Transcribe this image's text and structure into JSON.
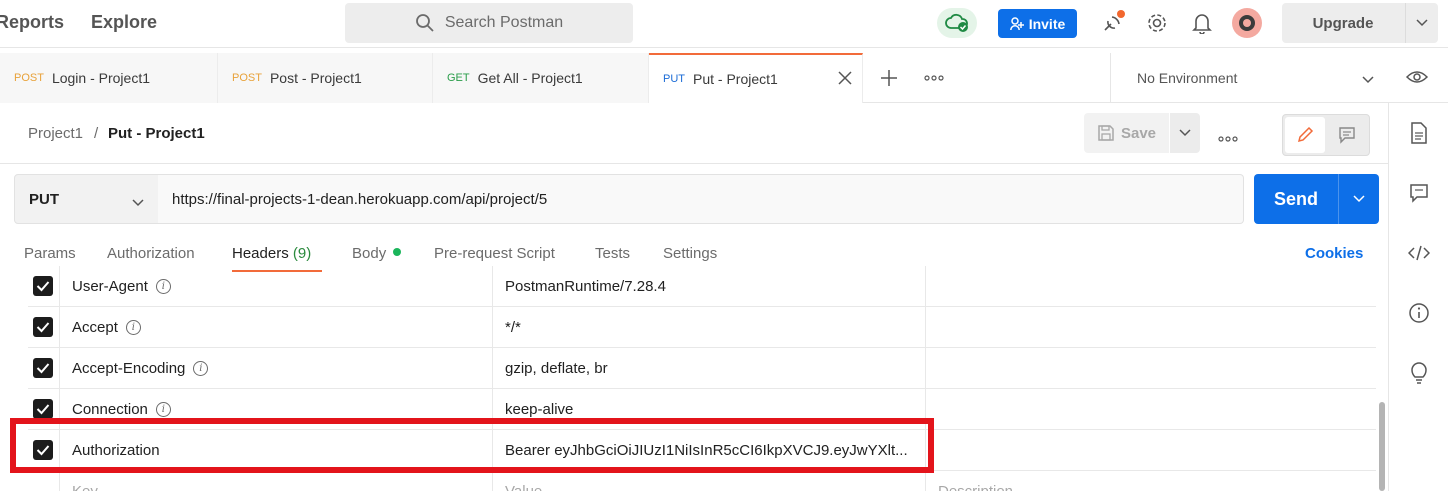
{
  "topbar": {
    "nav_reports": "Reports",
    "nav_explore": "Explore",
    "search_placeholder": "Search Postman",
    "invite_label": "Invite",
    "upgrade_label": "Upgrade"
  },
  "tabs": [
    {
      "method": "POST",
      "name": "Login - Project1",
      "method_color": "#e8a23a"
    },
    {
      "method": "POST",
      "name": "Post - Project1",
      "method_color": "#e8a23a"
    },
    {
      "method": "GET",
      "name": "Get All - Project1",
      "method_color": "#2a9d4a"
    },
    {
      "method": "PUT",
      "name": "Put - Project1",
      "method_color": "#1a6bd6"
    }
  ],
  "environment": {
    "selected": "No Environment"
  },
  "breadcrumb": {
    "collection": "Project1",
    "separator": "/",
    "request": "Put - Project1"
  },
  "save_label": "Save",
  "request": {
    "method": "PUT",
    "url": "https://final-projects-1-dean.herokuapp.com/api/project/5",
    "send_label": "Send"
  },
  "request_tabs": {
    "params": "Params",
    "authorization": "Authorization",
    "headers": "Headers",
    "headers_count": "(9)",
    "body": "Body",
    "prerequest": "Pre-request Script",
    "tests": "Tests",
    "settings": "Settings",
    "cookies": "Cookies"
  },
  "headers": [
    {
      "key": "User-Agent",
      "value": "PostmanRuntime/7.28.4",
      "checked": true
    },
    {
      "key": "Accept",
      "value": "*/*",
      "checked": true
    },
    {
      "key": "Accept-Encoding",
      "value": "gzip, deflate, br",
      "checked": true
    },
    {
      "key": "Connection",
      "value": "keep-alive",
      "checked": true
    },
    {
      "key": "Authorization",
      "value": "Bearer eyJhbGciOiJIUzI1NiIsInR5cCI6IkpXVCJ9.eyJwYXlt...",
      "checked": true
    }
  ],
  "new_row": {
    "key_placeholder": "Key",
    "value_placeholder": "Value",
    "description_placeholder": "Description"
  },
  "colors": {
    "accent_orange": "#f26b3a",
    "primary_blue": "#0d6fe8",
    "highlight_red": "#e3141b"
  }
}
